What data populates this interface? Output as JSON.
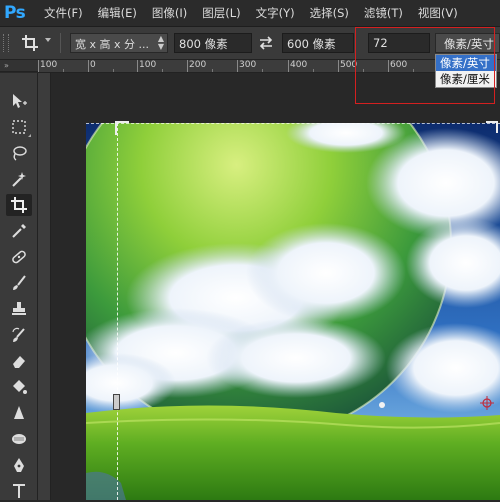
{
  "app": {
    "logo": "Ps"
  },
  "menu": [
    "文件(F)",
    "编辑(E)",
    "图像(I)",
    "图层(L)",
    "文字(Y)",
    "选择(S)",
    "滤镜(T)",
    "视图(V)"
  ],
  "options": {
    "tool_icon": "crop-icon",
    "ratio_label": "宽 x 高 x 分 ...",
    "width_value": "800 像素",
    "swap_icon": "swap-arrows-icon",
    "height_value": "600 像素",
    "resolution_value": "72",
    "unit_value": "像素/英寸",
    "unit_options": [
      "像素/英寸",
      "像素/厘米"
    ],
    "unit_selected_index": 0
  },
  "ruler": {
    "tab_label": "»",
    "ticks": [
      "100",
      "0",
      "100",
      "200",
      "300",
      "400",
      "500",
      "600"
    ]
  },
  "toolbar": {
    "tools": [
      "move-icon",
      "marquee-icon",
      "lasso-icon",
      "magic-wand-icon",
      "crop-icon",
      "eyedropper-icon",
      "healing-brush-icon",
      "brush-icon",
      "clone-stamp-icon",
      "history-brush-icon",
      "eraser-icon",
      "paint-bucket-icon",
      "blur-icon",
      "dodge-icon",
      "pen-icon",
      "type-icon"
    ],
    "active_tool": "crop-icon"
  },
  "canvas": {
    "image": "sky-planet-meadow-image"
  },
  "colors": {
    "accent": "#31a8ff",
    "highlight": "#d42020",
    "dropdown_selected": "#3470c8"
  }
}
